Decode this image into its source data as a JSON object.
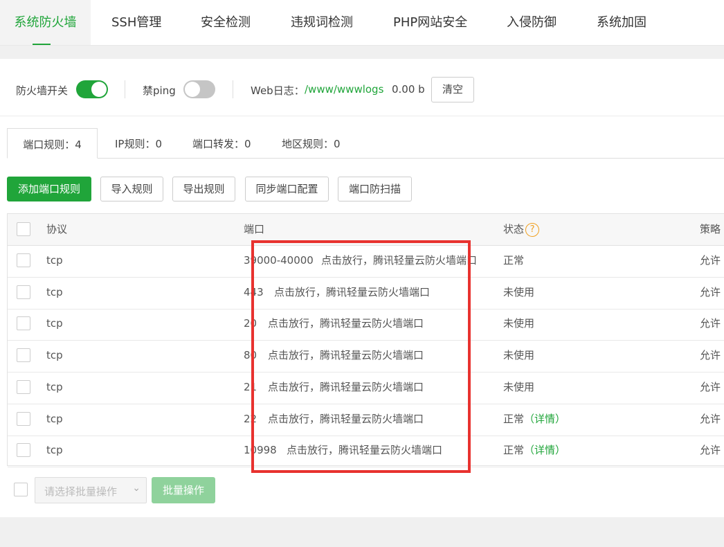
{
  "top_tabs": [
    {
      "label": "系统防火墙",
      "active": true
    },
    {
      "label": "SSH管理"
    },
    {
      "label": "安全检测"
    },
    {
      "label": "违规词检测"
    },
    {
      "label": "PHP网站安全"
    },
    {
      "label": "入侵防御"
    },
    {
      "label": "系统加固"
    }
  ],
  "toolbar": {
    "firewall_label": "防火墙开关",
    "firewall_on": true,
    "ping_label": "禁ping",
    "ping_on": false,
    "weblog_label": "Web日志：",
    "weblog_path": "/www/wwwlogs",
    "weblog_size": "0.00 b",
    "clear_label": "清空"
  },
  "sub_tabs": [
    {
      "label": "端口规则：4",
      "active": true
    },
    {
      "label": "IP规则：0"
    },
    {
      "label": "端口转发：0"
    },
    {
      "label": "地区规则：0"
    }
  ],
  "actions": {
    "add": "添加端口规则",
    "import": "导入规则",
    "export": "导出规则",
    "sync": "同步端口配置",
    "scan": "端口防扫描"
  },
  "table": {
    "headers": {
      "protocol": "协议",
      "port": "端口",
      "status": "状态",
      "policy": "策略"
    },
    "help_icon": "question-circle-icon",
    "rows": [
      {
        "protocol": "tcp",
        "port": "39000-40000",
        "link": "点击放行，腾讯轻量云防火墙端口",
        "status": "正常",
        "detail": "",
        "policy": "允许"
      },
      {
        "protocol": "tcp",
        "port": "443",
        "link": "点击放行，腾讯轻量云防火墙端口",
        "status": "未使用",
        "detail": "",
        "policy": "允许"
      },
      {
        "protocol": "tcp",
        "port": "20",
        "link": "点击放行，腾讯轻量云防火墙端口",
        "status": "未使用",
        "detail": "",
        "policy": "允许"
      },
      {
        "protocol": "tcp",
        "port": "80",
        "link": "点击放行，腾讯轻量云防火墙端口",
        "status": "未使用",
        "detail": "",
        "policy": "允许"
      },
      {
        "protocol": "tcp",
        "port": "21",
        "link": "点击放行，腾讯轻量云防火墙端口",
        "status": "未使用",
        "detail": "",
        "policy": "允许"
      },
      {
        "protocol": "tcp",
        "port": "22",
        "link": "点击放行，腾讯轻量云防火墙端口",
        "status": "正常",
        "detail": "（详情）",
        "policy": "允许"
      },
      {
        "protocol": "tcp",
        "port": "10998",
        "link": "点击放行，腾讯轻量云防火墙端口",
        "status": "正常",
        "detail": "（详情）",
        "policy": "允许"
      }
    ]
  },
  "batch": {
    "select_placeholder": "请选择批量操作",
    "button": "批量操作"
  },
  "colors": {
    "accent": "#20a53a",
    "highlight_box": "#e8322f"
  }
}
